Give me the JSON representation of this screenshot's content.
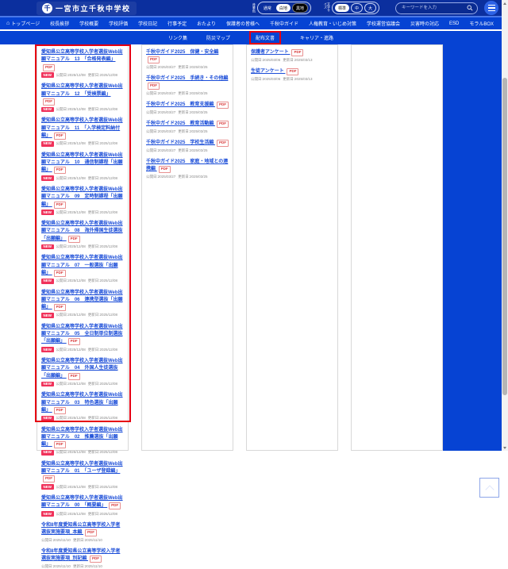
{
  "header": {
    "school_name": "一宮市立千秋中学校",
    "bg_control": {
      "label": "背景色",
      "options": [
        "通常",
        "白地",
        "黒地"
      ]
    },
    "font_control": {
      "label": "文字サイズ",
      "options": [
        "標準",
        "中",
        "大"
      ]
    },
    "search_placeholder": "キーワードを入力"
  },
  "nav": {
    "row1": [
      "トップページ",
      "校長挨拶",
      "学校概要",
      "学校評価",
      "学校日記",
      "行事予定",
      "おたより",
      "保護者の皆様へ",
      "千秋中ガイド",
      "人権教育・いじめ対策",
      "学校運営協議会",
      "災害時の対応",
      "ESD",
      "モラルBOX"
    ],
    "row2": [
      "リンク集",
      "防災マップ",
      "配布文書",
      "キャリア・進路"
    ],
    "highlighted_item": "配布文書"
  },
  "badges": {
    "pdf": "PDF",
    "new": "NEW"
  },
  "columns": [
    {
      "name": "web-application-manuals",
      "items": [
        {
          "title": "愛知県公立高等学校入学者選抜Web出願マニュアル　13　「合格発表編」",
          "new": true,
          "published": "公開日:2025/12/08",
          "updated": "更新日:2025/12/08"
        },
        {
          "title": "愛知県公立高等学校入学者選抜Web出願マニュアル　12　「受検票編」",
          "new": true,
          "published": "公開日:2025/12/08",
          "updated": "更新日:2025/12/08"
        },
        {
          "title": "愛知県公立高等学校入学者選抜Web出願マニュアル　11　「入学検定料納付編」",
          "new": true,
          "published": "公開日:2025/12/08",
          "updated": "更新日:2025/12/08"
        },
        {
          "title": "愛知県公立高等学校入学者選抜Web出願マニュアル　10　通信制課程「出願編」",
          "new": true,
          "published": "公開日:2025/12/08",
          "updated": "更新日:2025/12/08"
        },
        {
          "title": "愛知県公立高等学校入学者選抜Web出願マニュアル　09　定時制課程「出願編」",
          "new": true,
          "published": "公開日:2025/12/08",
          "updated": "更新日:2025/12/08"
        },
        {
          "title": "愛知県公立高等学校入学者選抜Web出願マニュアル　08　海外帰国生徒選抜「出願編」",
          "new": true,
          "published": "公開日:2025/12/08",
          "updated": "更新日:2025/12/08"
        },
        {
          "title": "愛知県公立高等学校入学者選抜Web出願マニュアル　07　一般選抜「出願編」",
          "new": true,
          "published": "公開日:2025/12/08",
          "updated": "更新日:2025/12/08"
        },
        {
          "title": "愛知県公立高等学校入学者選抜Web出願マニュアル　06　連携型選抜「出願編」",
          "new": true,
          "published": "公開日:2025/12/08",
          "updated": "更新日:2025/12/08"
        },
        {
          "title": "愛知県公立高等学校入学者選抜Web出願マニュアル　05　全日制単位制選抜「出願編」",
          "new": true,
          "published": "公開日:2025/12/08",
          "updated": "更新日:2025/12/08"
        },
        {
          "title": "愛知県公立高等学校入学者選抜Web出願マニュアル　04　外国人生徒選抜「出願編」",
          "new": true,
          "published": "公開日:2025/12/08",
          "updated": "更新日:2025/12/08"
        },
        {
          "title": "愛知県公立高等学校入学者選抜Web出願マニュアル　03　特色選抜「出願編」",
          "new": true,
          "published": "公開日:2025/12/08",
          "updated": "更新日:2025/12/08"
        },
        {
          "title": "愛知県公立高等学校入学者選抜Web出願マニュアル　02　推薦選抜「出願編」",
          "new": true,
          "published": "公開日:2025/12/08",
          "updated": "更新日:2025/12/08"
        },
        {
          "title": "愛知県公立高等学校入学者選抜Web出願マニュアル　01　「ユーザ登録編」",
          "new": true,
          "published": "公開日:2025/12/08",
          "updated": "更新日:2025/12/08"
        },
        {
          "title": "愛知県公立高等学校入学者選抜Web出願マニュアル　00　「概要編」",
          "new": true,
          "published": "公開日:2025/12/08",
          "updated": "更新日:2025/12/08"
        },
        {
          "title": "令和8年度愛知県公立高等学校入学者選抜実施要項_本編",
          "new": false,
          "published": "公開日:2025/11/10",
          "updated": "更新日:2025/11/10"
        },
        {
          "title": "令和8年度愛知県公立高等学校入学者選抜実施要項_別記編",
          "new": false,
          "published": "公開日:2025/11/10",
          "updated": "更新日:2025/11/10"
        }
      ]
    },
    {
      "name": "chiaki-guide",
      "items": [
        {
          "title": "千秋中ガイド2025　保健・安全編",
          "new": false,
          "published": "公開日:2025/03/27",
          "updated": "更新日:2025/03/25"
        },
        {
          "title": "千秋中ガイド2025　手続き・その他編",
          "new": false,
          "published": "公開日:2025/03/27",
          "updated": "更新日:2025/03/25"
        },
        {
          "title": "千秋中ガイド2025　教育支援編",
          "new": false,
          "published": "公開日:2025/03/27",
          "updated": "更新日:2025/03/25"
        },
        {
          "title": "千秋中ガイド2025　教育活動編",
          "new": false,
          "published": "公開日:2025/03/27",
          "updated": "更新日:2025/03/25"
        },
        {
          "title": "千秋中ガイド2025　学校生活編",
          "new": false,
          "published": "公開日:2025/03/27",
          "updated": "更新日:2025/03/25"
        },
        {
          "title": "千秋中ガイド2025　家庭・地域との連携編",
          "new": false,
          "published": "公開日:2025/03/27",
          "updated": "更新日:2025/03/25"
        }
      ]
    },
    {
      "name": "surveys",
      "items": [
        {
          "title": "保護者アンケート",
          "new": false,
          "published": "公開日:2025/03/06",
          "updated": "更新日:2025/03/13"
        },
        {
          "title": "生徒アンケート",
          "new": false,
          "published": "公開日:2025/03/06",
          "updated": "更新日:2025/03/13"
        }
      ]
    },
    {
      "name": "empty-column",
      "items": []
    }
  ]
}
